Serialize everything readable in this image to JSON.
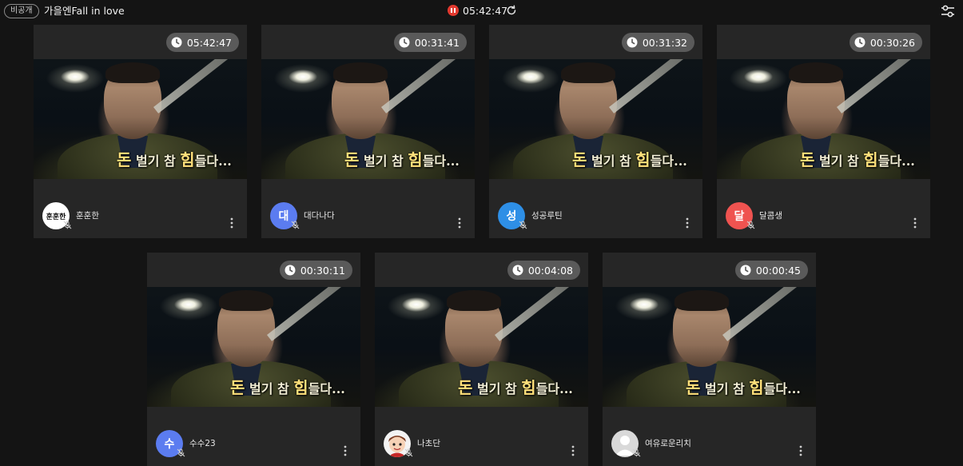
{
  "header": {
    "badge": "비공개",
    "title": "가을엔Fall in love",
    "elapsed": "05:42:47",
    "recording_color": "#e2392f"
  },
  "video": {
    "subtitle_a": "돈",
    "subtitle_b": " 벌기 참 ",
    "subtitle_c": "힘",
    "subtitle_d": "들다..."
  },
  "participants": [
    {
      "name": "훈훈한",
      "time": "05:42:47",
      "avatar_text": "훈훈한",
      "avatar_type": "logo",
      "avatar_color": "#ffffff",
      "mic": "muted"
    },
    {
      "name": "대다나다",
      "time": "00:31:41",
      "avatar_text": "대",
      "avatar_type": "initial",
      "avatar_color": "#5b7cf0",
      "mic": "muted"
    },
    {
      "name": "성공루틴",
      "time": "00:31:32",
      "avatar_text": "성",
      "avatar_type": "initial",
      "avatar_color": "#2e8fe6",
      "mic": "muted"
    },
    {
      "name": "달콤생",
      "time": "00:30:26",
      "avatar_text": "달",
      "avatar_type": "initial",
      "avatar_color": "#ef5350",
      "mic": "muted"
    },
    {
      "name": "수수23",
      "time": "00:30:11",
      "avatar_text": "수",
      "avatar_type": "initial",
      "avatar_color": "#5b7cf0",
      "mic": "muted"
    },
    {
      "name": "나초단",
      "time": "00:04:08",
      "avatar_text": "",
      "avatar_type": "cartoon",
      "avatar_color": "#f3f3f3",
      "mic": "muted"
    },
    {
      "name": "여유로운리치",
      "time": "00:00:45",
      "avatar_text": "",
      "avatar_type": "default",
      "avatar_color": "#d9d9d9",
      "mic": "muted"
    }
  ]
}
